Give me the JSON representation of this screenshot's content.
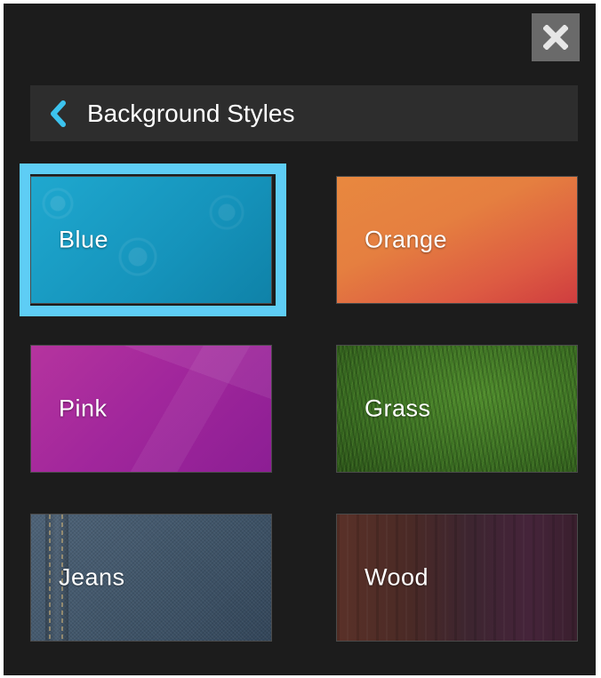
{
  "header": {
    "title": "Background Styles"
  },
  "icons": {
    "close": "close-icon",
    "back": "chevron-left-icon"
  },
  "colors": {
    "accent": "#5ecdf5",
    "panel": "#1c1c1c",
    "header": "#2d2d2d"
  },
  "styles": [
    {
      "label": "Blue",
      "selected": true
    },
    {
      "label": "Orange",
      "selected": false
    },
    {
      "label": "Pink",
      "selected": false
    },
    {
      "label": "Grass",
      "selected": false
    },
    {
      "label": "Jeans",
      "selected": false
    },
    {
      "label": "Wood",
      "selected": false
    }
  ]
}
